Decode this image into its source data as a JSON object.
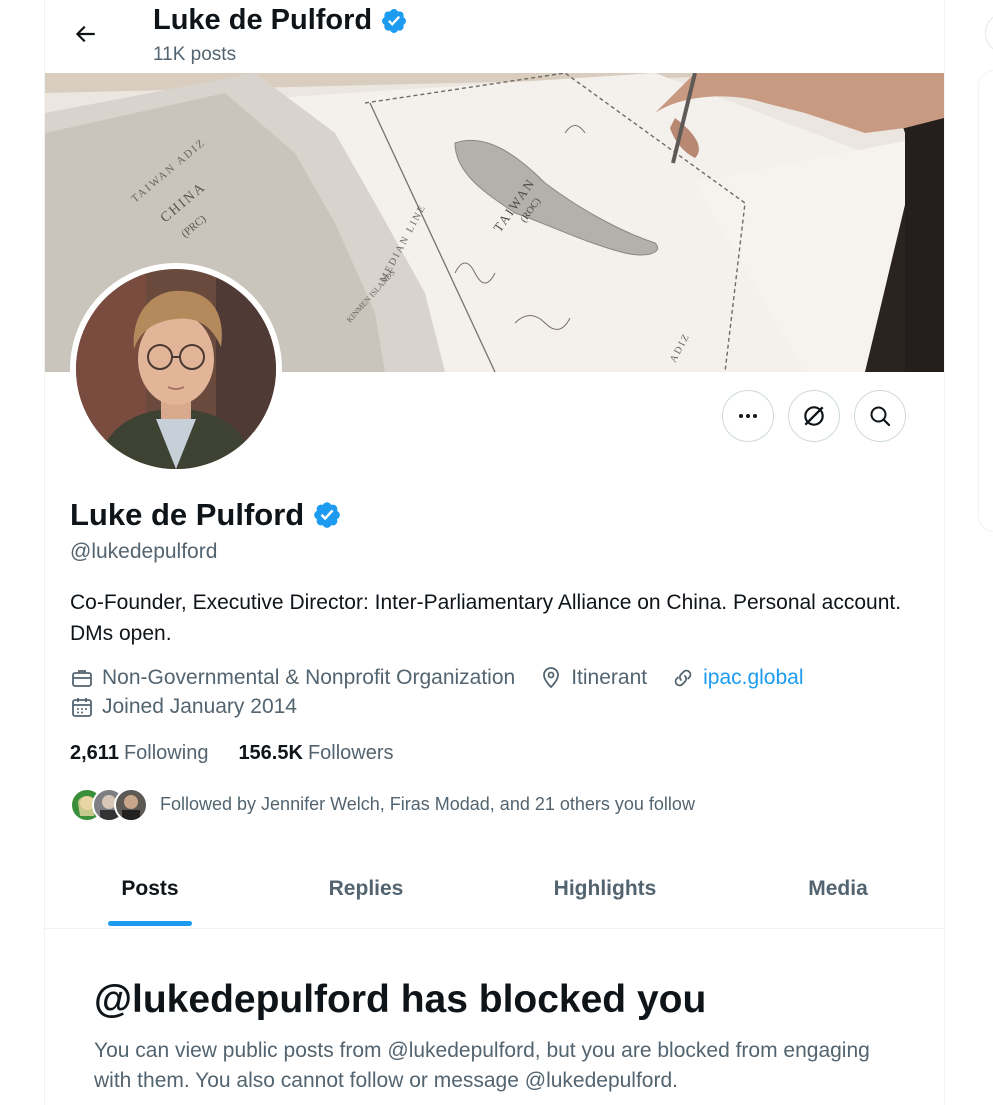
{
  "header": {
    "title": "Luke de Pulford",
    "post_count": "11K posts"
  },
  "profile": {
    "name": "Luke de Pulford",
    "handle": "@lukedepulford",
    "bio": "Co-Founder, Executive Director: Inter-Parliamentary Alliance on China. Personal account. DMs open.",
    "category": "Non-Governmental & Nonprofit Organization",
    "location": "Itinerant",
    "website": "ipac.global",
    "joined": "Joined January 2014",
    "following_count": "2,611",
    "following_label": "Following",
    "followers_count": "156.5K",
    "followers_label": "Followers",
    "followed_by": "Followed by Jennifer Welch, Firas Modad, and 21 others you follow"
  },
  "banner_text": {
    "taiwan_adiz": "TAIWAN ADIZ",
    "china": "CHINA",
    "prc": "(PRC)",
    "median_line": "MEDIAN LINE",
    "taiwan": "TAIWAN",
    "roc": "(ROC)",
    "kinmen": "KINMEN ISLANDS",
    "adiz": "ADIZ"
  },
  "tabs": [
    {
      "label": "Posts",
      "active": true
    },
    {
      "label": "Replies",
      "active": false
    },
    {
      "label": "Highlights",
      "active": false
    },
    {
      "label": "Media",
      "active": false
    }
  ],
  "blocked": {
    "title": "@lukedepulford has blocked you",
    "body": "You can view public posts from @lukedepulford, but you are blocked from engaging with them. You also cannot follow or message @lukedepulford."
  },
  "icons": {
    "back": "arrow-left-icon",
    "verified": "verified-badge-icon",
    "more": "more-icon",
    "grok": "grok-icon",
    "search": "search-icon",
    "briefcase": "briefcase-icon",
    "location": "location-pin-icon",
    "link": "link-icon",
    "calendar": "calendar-icon"
  },
  "colors": {
    "accent": "#1d9bf0",
    "text_primary": "#0f1419",
    "text_secondary": "#536471",
    "border": "#cfd9de"
  }
}
